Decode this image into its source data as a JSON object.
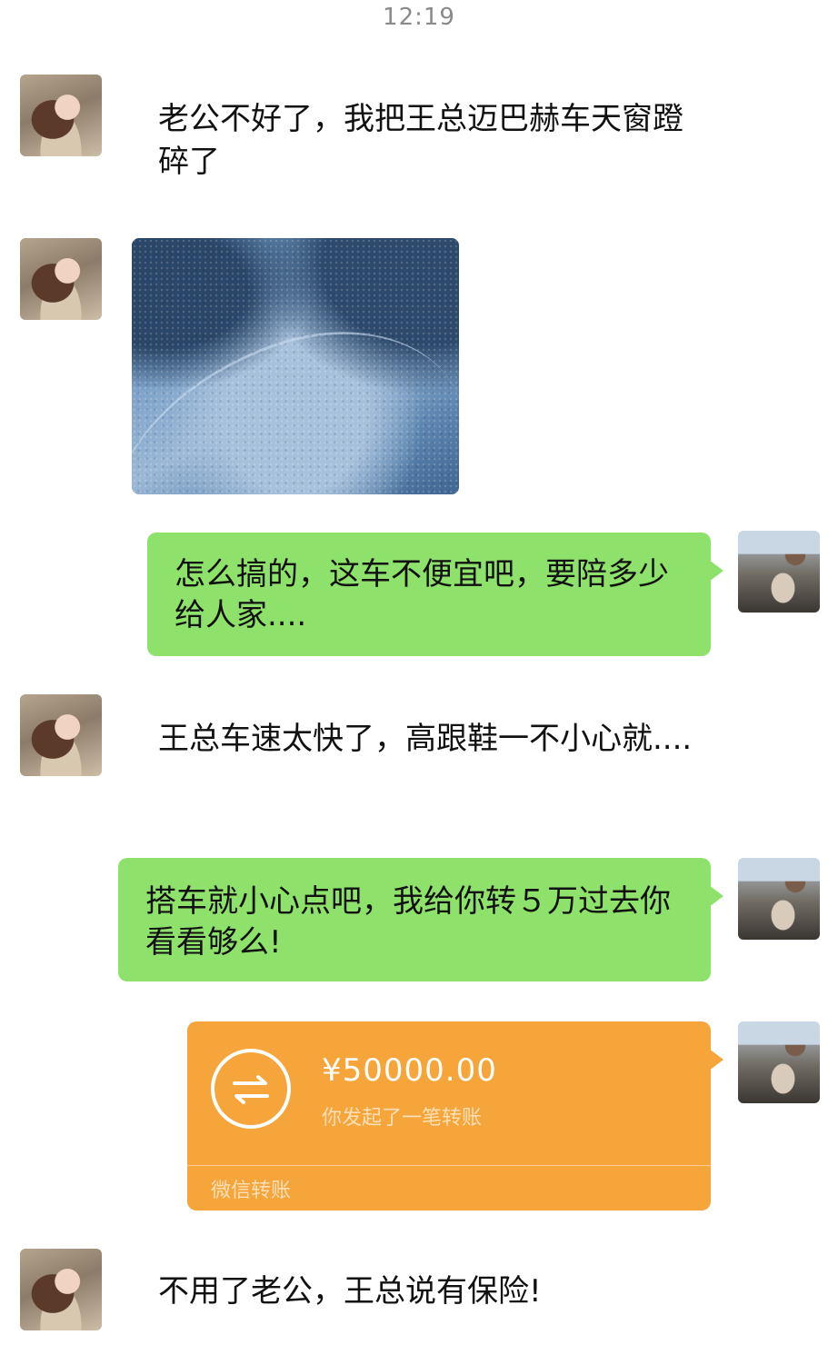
{
  "status_bar": {
    "time": "12:19"
  },
  "messages": {
    "m1": {
      "sender": "her",
      "text": "老公不好了，我把王总迈巴赫车天窗蹬碎了"
    },
    "m2": {
      "sender": "her",
      "type": "image"
    },
    "m3": {
      "sender": "me",
      "text": "怎么搞的，这车不便宜吧，要陪多少给人家...."
    },
    "m4": {
      "sender": "her",
      "text": "王总车速太快了，高跟鞋一不小心就...."
    },
    "m5": {
      "sender": "me",
      "text": "搭车就小心点吧，我给你转５万过去你看看够么!"
    },
    "m6": {
      "sender": "me",
      "type": "transfer",
      "amount": "¥50000.00",
      "subtitle": "你发起了一笔转账",
      "footer": "微信转账"
    },
    "m7": {
      "sender": "her",
      "text": "不用了老公，王总说有保险!"
    }
  },
  "colors": {
    "my_bubble": "#8ee26b",
    "transfer_card": "#f5a53a",
    "background": "#ffffff"
  }
}
